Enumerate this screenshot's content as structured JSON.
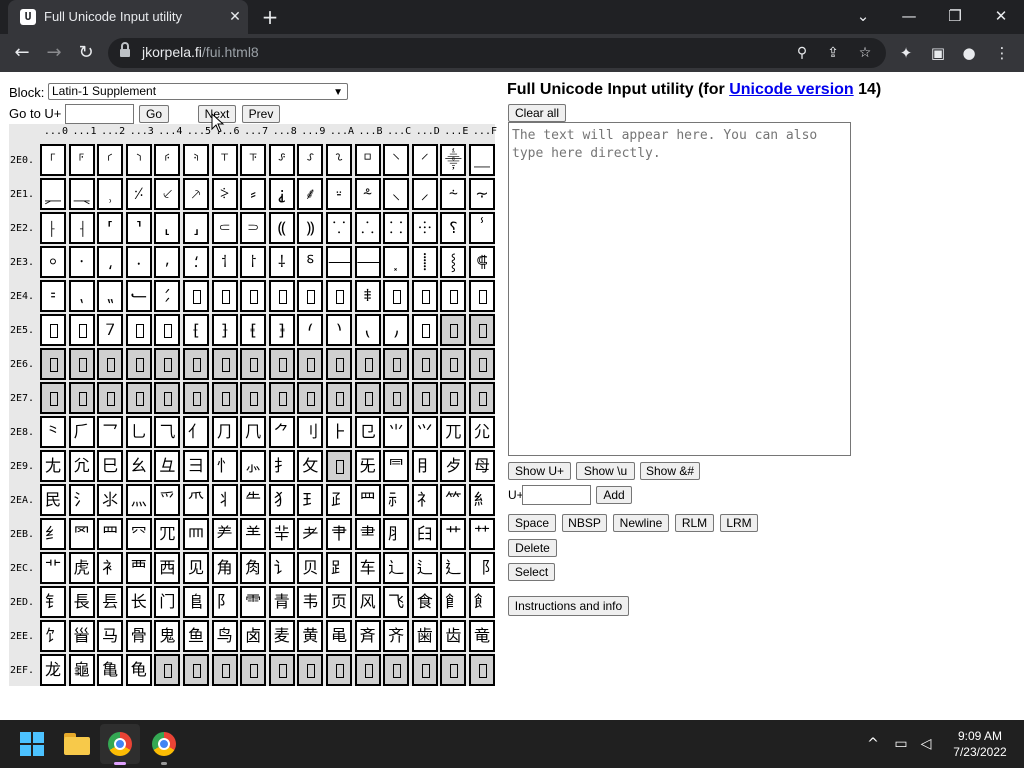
{
  "browser": {
    "tab_title": "Full Unicode Input utility",
    "favicon_glyph": "U",
    "url_host": "jkorpela.fi",
    "url_path": "/fui.html8",
    "window_controls": [
      "minimize",
      "restore",
      "close"
    ]
  },
  "page": {
    "block_label": "Block:",
    "block_selected": "Latin-1 Supplement",
    "goto_label": "Go to U+",
    "goto_value": "",
    "go_button": "Go",
    "next_button": "Next",
    "prev_button": "Prev",
    "title_prefix": "Full Unicode Input utility (for ",
    "title_link": "Unicode version",
    "title_suffix": " 14)",
    "clear_all_button": "Clear all",
    "output_placeholder": "The text will appear here. You can also type here directly.",
    "show_uplus_button": "Show U+",
    "show_u_button": "Show \\u",
    "show_amp_button": "Show &#",
    "uplus_label": "U+",
    "uplus_value": "",
    "add_button": "Add",
    "space_button": "Space",
    "nbsp_button": "NBSP",
    "newline_button": "Newline",
    "rlm_button": "RLM",
    "lrm_button": "LRM",
    "delete_button": "Delete",
    "select_button": "Select",
    "instructions_button": "Instructions and info"
  },
  "grid": {
    "column_headers": [
      "...0",
      "...1",
      "...2",
      "...3",
      "...4",
      "...5",
      "...6",
      "...7",
      "...8",
      "...9",
      "...A",
      "...B",
      "...C",
      "...D",
      "...E",
      "...F"
    ],
    "rows": [
      {
        "label": "2E0.",
        "cells": [
          "⸀",
          "⸁",
          "⸂",
          "⸃",
          "⸄",
          "⸅",
          "⸆",
          "⸇",
          "⸈",
          "⸉",
          "⸊",
          "⸋",
          "⸌",
          "⸍",
          "⸎",
          "⸏"
        ]
      },
      {
        "label": "2E1.",
        "cells": [
          "⸐",
          "⸑",
          "⸒",
          "⸓",
          "⸔",
          "⸕",
          "⸖",
          "⸗",
          "⸘",
          "⸙",
          "⸚",
          "⸛",
          "⸜",
          "⸝",
          "⸞",
          "⸟"
        ]
      },
      {
        "label": "2E2.",
        "cells": [
          "⸠",
          "⸡",
          "⸢",
          "⸣",
          "⸤",
          "⸥",
          "⸦",
          "⸧",
          "⸨",
          "⸩",
          "⸪",
          "⸫",
          "⸬",
          "⸭",
          "⸮",
          "ⸯ"
        ]
      },
      {
        "label": "2E3.",
        "cells": [
          "⸰",
          "⸱",
          "⸲",
          "⸳",
          "⸴",
          "⸵",
          "⸶",
          "⸷",
          "⸸",
          "⸹",
          "⸺",
          "⸻",
          "⸼",
          "⸽",
          "⸾",
          "⸿"
        ]
      },
      {
        "label": "2E4.",
        "cells": [
          "⹀",
          "⹁",
          "⹂",
          "⹃",
          "⹄",
          "R",
          "R",
          "R",
          "R",
          "R",
          "R",
          "⹋",
          "R",
          "R",
          "R",
          "R"
        ]
      },
      {
        "label": "2E5.",
        "cells": [
          "R",
          "R",
          "⹒",
          "R",
          "R",
          "⹕",
          "⹖",
          "⹗",
          "⹘",
          "⹙",
          "⹚",
          "⹛",
          "⹜",
          "R",
          "X",
          "X"
        ]
      },
      {
        "label": "2E6.",
        "cells": [
          "X",
          "X",
          "X",
          "X",
          "X",
          "X",
          "X",
          "X",
          "X",
          "X",
          "X",
          "X",
          "X",
          "X",
          "X",
          "X"
        ]
      },
      {
        "label": "2E7.",
        "cells": [
          "X",
          "X",
          "X",
          "X",
          "X",
          "X",
          "X",
          "X",
          "X",
          "X",
          "X",
          "X",
          "X",
          "X",
          "X",
          "X"
        ]
      },
      {
        "label": "2E8.",
        "cells": [
          "⺀",
          "⺁",
          "⺂",
          "⺃",
          "⺄",
          "⺅",
          "⺆",
          "⺇",
          "⺈",
          "⺉",
          "⺊",
          "⺋",
          "⺌",
          "⺍",
          "⺎",
          "⺏"
        ]
      },
      {
        "label": "2E9.",
        "cells": [
          "⺐",
          "⺑",
          "⺒",
          "⺓",
          "⺔",
          "⺕",
          "⺖",
          "⺗",
          "⺘",
          "⺙",
          "X",
          "⺛",
          "⺜",
          "⺝",
          "⺞",
          "⺟"
        ]
      },
      {
        "label": "2EA.",
        "cells": [
          "⺠",
          "⺡",
          "⺢",
          "⺣",
          "⺤",
          "⺥",
          "⺦",
          "⺧",
          "⺨",
          "⺩",
          "⺪",
          "⺫",
          "⺬",
          "⺭",
          "⺮",
          "⺯"
        ]
      },
      {
        "label": "2EB.",
        "cells": [
          "⺰",
          "⺱",
          "⺲",
          "⺳",
          "⺴",
          "⺵",
          "⺶",
          "⺷",
          "⺸",
          "⺹",
          "⺺",
          "⺻",
          "⺼",
          "⺽",
          "⺾",
          "⺿"
        ]
      },
      {
        "label": "2EC.",
        "cells": [
          "⻀",
          "⻁",
          "⻂",
          "⻃",
          "⻄",
          "⻅",
          "⻆",
          "⻇",
          "⻈",
          "⻉",
          "⻊",
          "⻋",
          "⻌",
          "⻍",
          "⻎",
          "⻏"
        ]
      },
      {
        "label": "2ED.",
        "cells": [
          "⻐",
          "⻑",
          "⻒",
          "⻓",
          "⻔",
          "⻕",
          "⻖",
          "⻗",
          "⻘",
          "⻙",
          "⻚",
          "⻛",
          "⻜",
          "⻝",
          "⻞",
          "⻟"
        ]
      },
      {
        "label": "2EE.",
        "cells": [
          "⻠",
          "⻡",
          "⻢",
          "⻣",
          "⻤",
          "⻥",
          "⻦",
          "⻧",
          "⻨",
          "⻩",
          "⻪",
          "⻫",
          "⻬",
          "⻭",
          "⻮",
          "⻯"
        ]
      },
      {
        "label": "2EF.",
        "cells": [
          "⻰",
          "⻱",
          "⻲",
          "⻳",
          "X",
          "X",
          "X",
          "X",
          "X",
          "X",
          "X",
          "X",
          "X",
          "X",
          "X",
          "X"
        ]
      }
    ]
  },
  "taskbar": {
    "time": "9:09 AM",
    "date": "7/23/2022",
    "accent": "#4cc2ff"
  }
}
